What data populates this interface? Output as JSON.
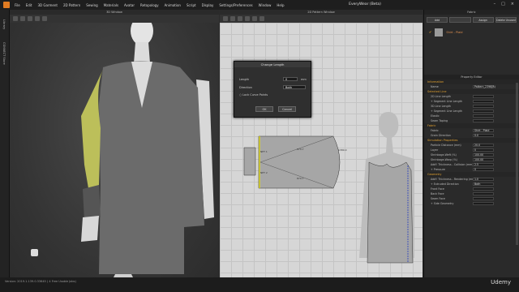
{
  "menu": {
    "items": [
      "File",
      "Edit",
      "3D Garment",
      "2D Pattern",
      "Sewing",
      "Materials",
      "Avatar",
      "Retopology",
      "Animation",
      "Script",
      "Display",
      "Settings/Preferences",
      "Window",
      "Help"
    ],
    "app_title": "EveryWear (Beta)"
  },
  "left_strip": {
    "tabs": [
      "Library",
      "CONNECT Store"
    ]
  },
  "win3d": {
    "title": "3D Window"
  },
  "win2d": {
    "title": "2D Pattern Window"
  },
  "pattern_labels": {
    "a": "NET 1",
    "b": "870.7",
    "c": "870.7",
    "d": "NET 2",
    "e": "1380.0"
  },
  "dialog": {
    "title": "Change Length",
    "length_label": "Length",
    "length_value": "0",
    "length_unit": "mm",
    "direction_label": "Direction",
    "direction_value": "Both",
    "lock_label": "Lock Curve Points",
    "ok": "OK",
    "cancel": "Cancel"
  },
  "fabric_panel": {
    "title": "Fabric",
    "buttons": [
      "Add",
      "",
      "Assign",
      "Delete Unused"
    ],
    "item_name": "Shirt - Plaid"
  },
  "property_editor": {
    "title": "Property Editor",
    "rows": [
      {
        "type": "sec",
        "k": "Information"
      },
      {
        "type": "pr",
        "k": "Name",
        "v": "Pattern_2396(R)"
      },
      {
        "type": "sec",
        "k": "Selected Line"
      },
      {
        "type": "pr",
        "k": "2D Line Length",
        "v": ""
      },
      {
        "type": "pr",
        "k": "+ Segment Line Length",
        "v": ""
      },
      {
        "type": "pr",
        "k": "3D Line Length",
        "v": ""
      },
      {
        "type": "pr",
        "k": "+ Segment Line Length",
        "v": ""
      },
      {
        "type": "pr",
        "k": "Elastic",
        "v": ""
      },
      {
        "type": "pr",
        "k": "Seam Taping",
        "v": ""
      },
      {
        "type": "sec",
        "k": "Fabric"
      },
      {
        "type": "pr",
        "k": "Fabric",
        "v": "Shirt - Plaid"
      },
      {
        "type": "pr",
        "k": "Grain Direction",
        "v": "0.0"
      },
      {
        "type": "sec",
        "k": "Simulation Properties"
      },
      {
        "type": "pr",
        "k": "Particle Distance (mm)",
        "v": "20.0"
      },
      {
        "type": "pr",
        "k": "Layer",
        "v": "0"
      },
      {
        "type": "pr",
        "k": "Shrinkage-Weft (%)",
        "v": "100.00"
      },
      {
        "type": "pr",
        "k": "Shrinkage-Warp (%)",
        "v": "100.00"
      },
      {
        "type": "pr",
        "k": "Add'l Thickness - Collision (mm)",
        "v": "2.5"
      },
      {
        "type": "pr",
        "k": "+ Pressure",
        "v": "0"
      },
      {
        "type": "sec",
        "k": "Geometry"
      },
      {
        "type": "pr",
        "k": "Add'l Thickness - Rendering (mm)",
        "v": "1.0"
      },
      {
        "type": "pr",
        "k": "+ Extruded Direction",
        "v": "Both"
      },
      {
        "type": "pr",
        "k": "Front Face",
        "v": ""
      },
      {
        "type": "pr",
        "k": "Back Face",
        "v": ""
      },
      {
        "type": "pr",
        "k": "Seam Face",
        "v": ""
      },
      {
        "type": "pr",
        "k": "+ Side Geometry",
        "v": ""
      }
    ]
  },
  "status": {
    "text": "Version:  2019.1.139.0.33645   ( 4 Free Usable Jobs)"
  },
  "watermark": "Udemy",
  "colors": {
    "sleeve": "#bcbf5a",
    "shirt": "#6a6a6a",
    "pattern": "#a6a6a6",
    "accent": "#e0a030"
  }
}
